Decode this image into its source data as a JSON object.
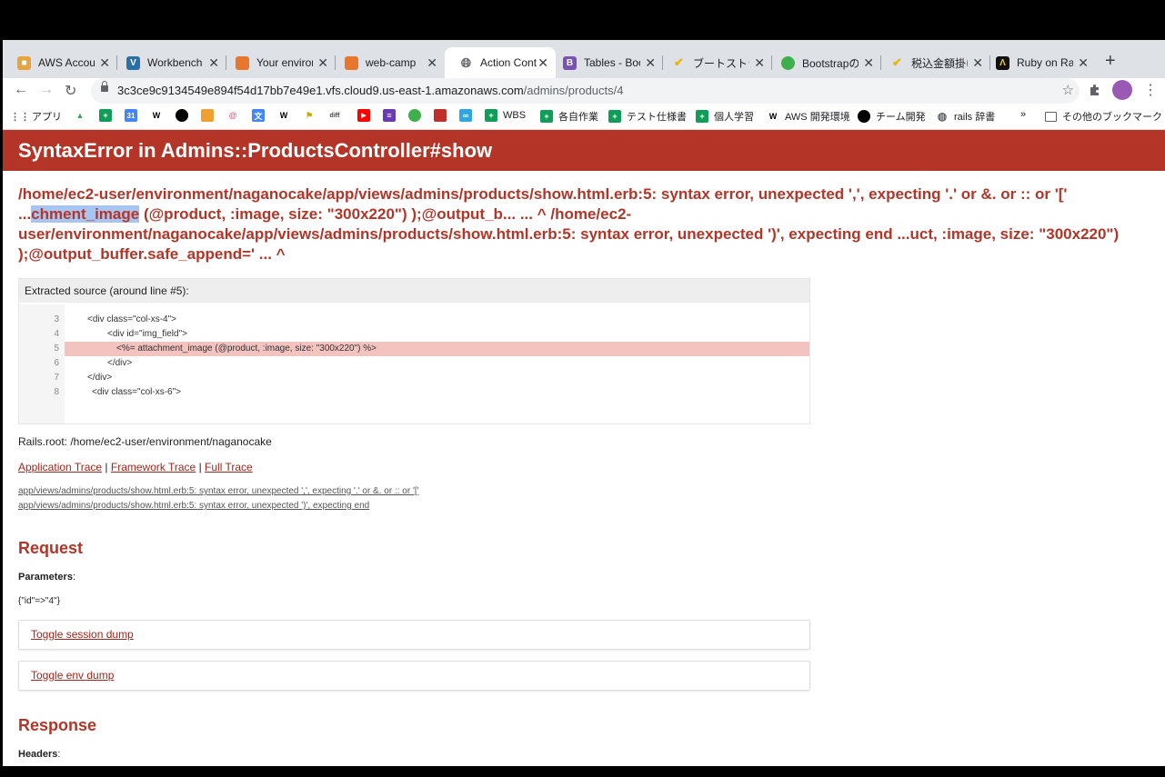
{
  "browser": {
    "tabs": [
      {
        "label": "AWS Accour",
        "icon": "aws-icon",
        "color": "#e8a33d"
      },
      {
        "label": "Workbench",
        "icon": "workbench-v-icon",
        "color": "#2c6ea6"
      },
      {
        "label": "Your environ",
        "icon": "cloud9-icon",
        "color": "#e8762c"
      },
      {
        "label": "web-camp",
        "icon": "cloud9-icon",
        "color": "#e8762c"
      },
      {
        "label": "Action Contr",
        "icon": "globe-icon",
        "color": "#5f6368"
      },
      {
        "label": "Tables - Boo",
        "icon": "bootstrap-icon",
        "color": "#7952b3"
      },
      {
        "label": "ブートストラ",
        "icon": "qiita-check-icon",
        "color": "#f0b400"
      },
      {
        "label": "Bootstrapの",
        "icon": "circle-green-icon",
        "color": "#3db04c"
      },
      {
        "label": "税込金額掛け",
        "icon": "qiita-check-icon",
        "color": "#f0b400"
      },
      {
        "label": "Ruby on Rai",
        "icon": "ruby-a-icon",
        "color": "#111111"
      }
    ],
    "active_tab": 4,
    "url_host": "3c3ce9c9134549e894f54d17bb7e49e1.vfs.cloud9.us-east-1.amazonaws.com",
    "url_path": "/admins/products/4",
    "bookmarks": [
      {
        "label": "アプリ",
        "icon": "apps-grid-icon",
        "color": "#4285f4"
      },
      {
        "label": "",
        "icon": "drive-icon",
        "color": "#34a853"
      },
      {
        "label": "",
        "icon": "sheets-icon",
        "color": "#0f9d58"
      },
      {
        "label": "",
        "icon": "calendar-icon",
        "color": "#4285f4"
      },
      {
        "label": "",
        "icon": "wikipedia-w-icon",
        "color": "#000000"
      },
      {
        "label": "",
        "icon": "github-icon",
        "color": "#000000"
      },
      {
        "label": "",
        "icon": "box-icon",
        "color": "#f0a030"
      },
      {
        "label": "",
        "icon": "swirl-icon",
        "color": "#e85c8a"
      },
      {
        "label": "",
        "icon": "translate-icon",
        "color": "#4285f4"
      },
      {
        "label": "",
        "icon": "wikipedia-w-icon",
        "color": "#000000"
      },
      {
        "label": "",
        "icon": "flag-icon",
        "color": "#f0c000"
      },
      {
        "label": "",
        "icon": "diff-icon",
        "color": "#444444"
      },
      {
        "label": "",
        "icon": "youtube-icon",
        "color": "#ff0000"
      },
      {
        "label": "",
        "icon": "list-icon",
        "color": "#6a3ab2"
      },
      {
        "label": "",
        "icon": "circle-green-icon",
        "color": "#3db04c"
      },
      {
        "label": "",
        "icon": "book-red-icon",
        "color": "#c0302a"
      },
      {
        "label": "",
        "icon": "infinity-icon",
        "color": "#2ea6e0"
      },
      {
        "label": "WBS",
        "icon": "sheets-icon",
        "color": "#0f9d58"
      },
      {
        "label": "各自作業",
        "icon": "sheets-icon",
        "color": "#0f9d58"
      },
      {
        "label": "テスト仕様書",
        "icon": "sheets-icon",
        "color": "#0f9d58"
      },
      {
        "label": "個人学習",
        "icon": "sheets-icon",
        "color": "#0f9d58"
      },
      {
        "label": "AWS 開発環境",
        "icon": "wikipedia-w-icon",
        "color": "#000000"
      },
      {
        "label": "チーム開発",
        "icon": "github-icon",
        "color": "#000000"
      },
      {
        "label": "rails 辞書",
        "icon": "globe-icon",
        "color": "#5f6368"
      }
    ],
    "bookmarks_more": "»",
    "other_bookmarks": "その他のブックマーク"
  },
  "error": {
    "title": "SyntaxError in Admins::ProductsController#show",
    "message_part1": "/home/ec2-user/environment/naganocake/app/views/admins/products/show.html.erb:5: syntax error, unexpected ',', expecting '.' or &. or :: or '['",
    "message_prefix": "...",
    "message_highlight": "chment_image",
    "message_part2": " (@product, :image, size: \"300x220\") );@output_b... ... ^ /home/ec2-user/environment/naganocake/app/views/admins/products/show.html.erb:5: syntax error, unexpected ')', expecting end ...uct, :image, size: \"300x220\") );@output_buffer.safe_append=' ... ^"
  },
  "source": {
    "title": "Extracted source (around line #5):",
    "lines": [
      {
        "num": "3",
        "code": "<div class=\"col-xs-4\">"
      },
      {
        "num": "4",
        "code": "<div id=\"img_field\">"
      },
      {
        "num": "5",
        "code": "<%= attachment_image (@product, :image, size: \"300x220\") %>"
      },
      {
        "num": "6",
        "code": "</div>"
      },
      {
        "num": "7",
        "code": "</div>"
      },
      {
        "num": "8",
        "code": "<div class=\"col-xs-6\">"
      }
    ]
  },
  "rails_root": "Rails.root: /home/ec2-user/environment/naganocake",
  "traces": {
    "application": "Application Trace",
    "framework": "Framework Trace",
    "full": "Full Trace",
    "sep": "|",
    "rows": [
      "app/views/admins/products/show.html.erb:5: syntax error, unexpected ',', expecting '.' or &. or :: or '['",
      "app/views/admins/products/show.html.erb:5: syntax error, unexpected ')', expecting end"
    ]
  },
  "request": {
    "heading": "Request",
    "params_label": "Parameters",
    "params_value": "{\"id\"=>\"4\"}",
    "toggle_session": "Toggle session dump",
    "toggle_env": "Toggle env dump"
  },
  "response": {
    "heading": "Response",
    "headers_label": "Headers"
  },
  "colors": {
    "accent": "#b43527",
    "link": "#a3251b",
    "highlight_line": "#f3c3c0"
  }
}
